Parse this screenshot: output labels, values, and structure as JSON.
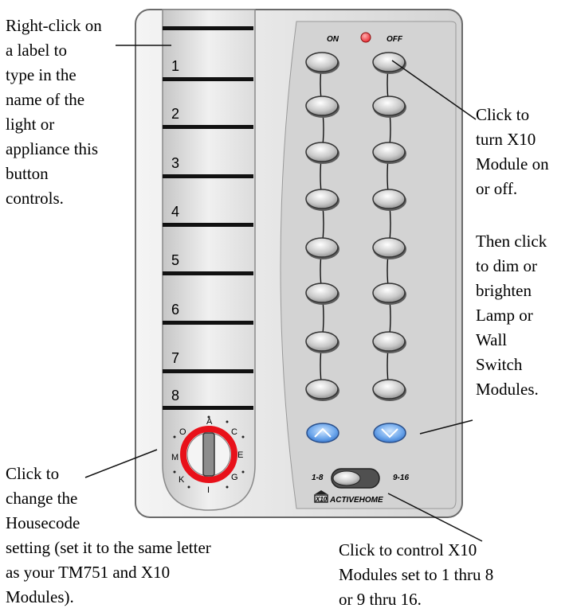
{
  "notes": {
    "labels": "Right-click on\na label to\ntype in the\nname of the\nlight or\nappliance this\nbutton\ncontrols.",
    "onoff": "Click to\nturn X10\nModule on\nor off.",
    "dim": "Then click\nto dim or\nbrighten\nLamp or\nWall\nSwitch\nModules.",
    "housecode": "Click to\nchange the\nHousecode\nsetting (set it to the same letter\nas your TM751 and X10\nModules).",
    "range": "Click to control X10\nModules set to 1 thru 8\nor 9 thru 16."
  },
  "remote": {
    "on_label": "ON",
    "off_label": "OFF",
    "labels": [
      "1",
      "2",
      "3",
      "4",
      "5",
      "6",
      "7",
      "8"
    ],
    "dial_letters": [
      "A",
      "C",
      "E",
      "G",
      "I",
      "K",
      "M",
      "O"
    ],
    "range_low": "1-8",
    "range_high": "9-16",
    "brand": "ACTIVEHOME",
    "brand_logo": "X10"
  },
  "colors": {
    "body": "#e4e4e4",
    "dial_ring": "#e8111a",
    "dim_button": "#6fa8ec",
    "led": "#e8232b"
  }
}
